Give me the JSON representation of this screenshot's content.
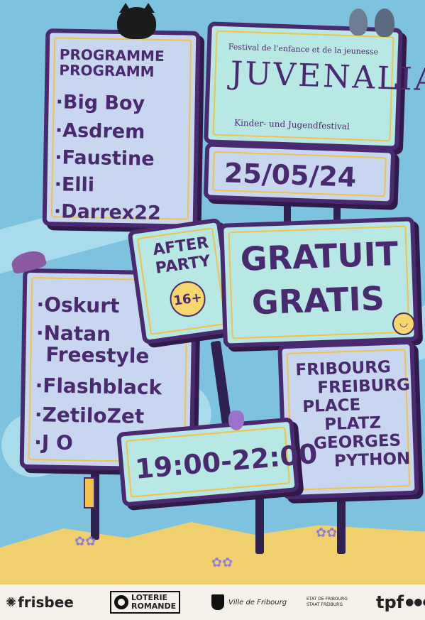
{
  "colors": {
    "sky": "#7ec3dd",
    "board_purple": "#4a2a6e",
    "board_fill_light": "#c8d7ef",
    "board_fill_mint": "#b8e8e4",
    "accent_yellow": "#f2c34a",
    "sand": "#f0cf6d",
    "footer": "#f4f1ea"
  },
  "programme": {
    "title_fr": "PROGRAMME",
    "title_de": "PROGRAMM",
    "acts": [
      "Big Boy",
      "Asdrem",
      "Faustine",
      "Elli",
      "Darrex22"
    ]
  },
  "programme2": {
    "acts": [
      "Oskurt",
      "Natan",
      "Freestyle",
      "Flashblack",
      "ZetiloZet",
      "J O"
    ]
  },
  "festival": {
    "top_line": "Festival de l'enfance et de la jeunesse",
    "name": "JUVENALIA",
    "bottom_line": "Kinder- und Jugendfestival"
  },
  "date": "25/05/24",
  "after_party": {
    "line1": "AFTER",
    "line2": "PARTY",
    "age": "16+"
  },
  "price": {
    "fr": "GRATUIT",
    "de": "GRATIS"
  },
  "place": {
    "lines": [
      "FRIBOURG",
      "FREIBURG",
      "PLACE",
      "PLATZ",
      "GEORGES",
      "PYTHON"
    ]
  },
  "time": "19:00-22:00",
  "footer": {
    "frisbee": "frisbee",
    "loterie1": "LOTERIE",
    "loterie2": "ROMANDE",
    "ville": "Ville de Fribourg",
    "etat1": "ETAT DE FRIBOURG",
    "etat2": "STAAT FREIBURG",
    "tpf": "tpf"
  },
  "icons": [
    "cat-icon",
    "pigeon-icon",
    "cap-icon",
    "smiley-icon",
    "flower-icon",
    "vase-icon",
    "speaker-icon"
  ]
}
